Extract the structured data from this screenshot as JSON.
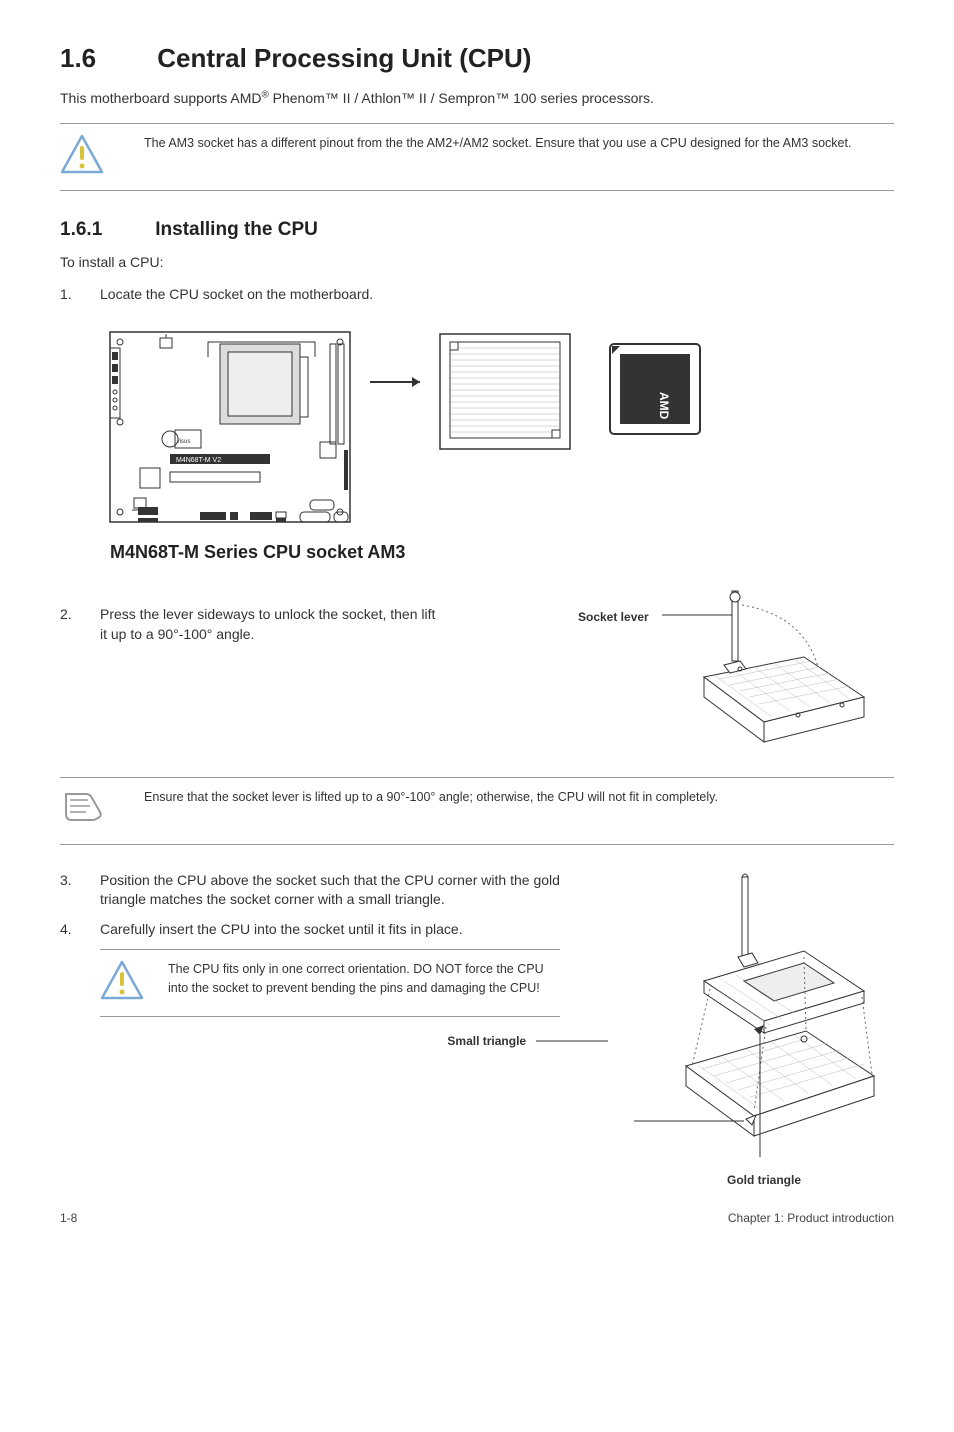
{
  "section": {
    "number": "1.6",
    "title": "Central Processing Unit (CPU)",
    "intro_pre": "This motherboard supports AMD",
    "intro_reg": "®",
    "intro_post": " Phenom™ II / Athlon™ II / Sempron™ 100 series processors."
  },
  "warning1": "The AM3 socket has a different pinout from the the AM2+/AM2 socket. Ensure that you use a CPU designed for the AM3 socket.",
  "subsection": {
    "number": "1.6.1",
    "title": "Installing the CPU",
    "lead": "To install a CPU:"
  },
  "steps": {
    "s1": {
      "num": "1.",
      "text": "Locate the CPU socket on the motherboard."
    },
    "s2": {
      "num": "2.",
      "text": "Press the lever sideways to unlock the socket, then lift it up to a 90°-100° angle."
    },
    "s3": {
      "num": "3.",
      "text": "Position the CPU above the socket such that the CPU corner with the gold triangle matches the socket corner with a small triangle."
    },
    "s4": {
      "num": "4.",
      "text": "Carefully insert the CPU into the socket until it fits in place."
    }
  },
  "figure": {
    "board_label": "M4N68T-M V2",
    "caption": "M4N68T-M Series CPU socket AM3",
    "cpu_brand": "AMD"
  },
  "labels": {
    "socket_lever": "Socket lever",
    "small_triangle": "Small triangle",
    "gold_triangle": "Gold triangle"
  },
  "note1": "Ensure that the socket lever is lifted up to a 90°-100° angle; otherwise, the CPU will not fit in completely.",
  "warning2": "The CPU fits only in one correct orientation. DO NOT force the CPU into the socket to prevent bending the pins and damaging the CPU!",
  "footer": {
    "left": "1-8",
    "right": "Chapter 1: Product introduction"
  }
}
